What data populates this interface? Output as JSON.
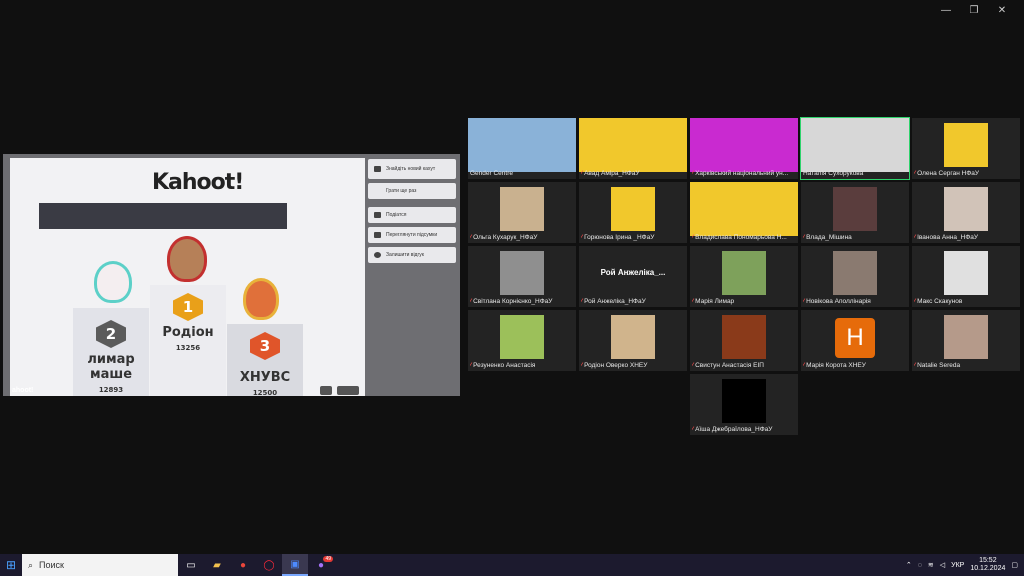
{
  "window": {
    "controls": [
      "—",
      "❐",
      "✕"
    ]
  },
  "kahoot": {
    "logo": "Kahoot!",
    "corner_logo": "ahoot!",
    "podium": [
      {
        "rank": "2",
        "name": "лимар маше",
        "score": "12893",
        "color": "#5b5b5b"
      },
      {
        "rank": "1",
        "name": "Родіон",
        "score": "13256",
        "color": "#e9a019"
      },
      {
        "rank": "3",
        "name": "ХНУВС",
        "score": "12500",
        "color": "#e0552a"
      }
    ],
    "menu": [
      "Знайдіть новий кахут",
      "Грати ще раз",
      "Подіатся",
      "Переглянути підсумки",
      "Залишити відгук"
    ]
  },
  "gallery": {
    "participants": [
      {
        "name": "Gender Centre",
        "muted": false,
        "bg": "#8ab2d8"
      },
      {
        "name": "Авад Аміра_НФаУ",
        "muted": true,
        "bg": "#f1c82c"
      },
      {
        "name": "Харківський національний ун...",
        "muted": true,
        "bg": "#c92ad0"
      },
      {
        "name": "Наталія Сухорукова",
        "muted": false,
        "bg": "#d7d7d7"
      },
      {
        "name": "Олена Серган НФаУ",
        "muted": true,
        "bg": "#f1c82c"
      },
      {
        "name": "Ольга Кухарук_НФаУ",
        "muted": true,
        "bg": "#c9b18f"
      },
      {
        "name": "Горюнова Ірина _НФаУ",
        "muted": true,
        "bg": "#f1c82c"
      },
      {
        "name": "Владислава Пономарьова Н...",
        "muted": true,
        "bg": "#f1c82c"
      },
      {
        "name": "Влада_Мішина",
        "muted": true,
        "bg": "#5a3d3d"
      },
      {
        "name": "Іванова Анна_НФаУ",
        "muted": true,
        "bg": "#d1c3b8"
      },
      {
        "name": "Світлана Корнієнко_НФаУ",
        "muted": true,
        "bg": "#8f8f8f"
      },
      {
        "name": "Рой Анжеліка_НФаУ",
        "muted": true,
        "bg": "#232323",
        "big_text": "Рой Анжеліка_..."
      },
      {
        "name": "Марія Лимар",
        "muted": true,
        "bg": "#7ea15b"
      },
      {
        "name": "Новікова Аполлінарія",
        "muted": true,
        "bg": "#8a7a70"
      },
      {
        "name": "Макс Скакунов",
        "muted": true,
        "bg": "#e0e0e0"
      },
      {
        "name": "Резуненко Анастасія",
        "muted": true,
        "bg": "#9cc05a"
      },
      {
        "name": "Родіон Оверко ХНЕУ",
        "muted": true,
        "bg": "#d0b48c"
      },
      {
        "name": "Свистун Анастасія ЕІП",
        "muted": true,
        "bg": "#8a3a1a"
      },
      {
        "name": "Марія Корота ХНЕУ",
        "muted": true,
        "bg": "#232323",
        "initial": "H"
      },
      {
        "name": "Natalie Sereda",
        "muted": true,
        "bg": "#b59a8a"
      },
      {
        "name": "Аїша Джебраїлова_НФаУ",
        "muted": true,
        "bg": "#000000"
      }
    ]
  },
  "taskbar": {
    "search_placeholder": "Поиск",
    "zoom_badge": "49",
    "lang": "УКР",
    "time": "15:52",
    "date": "10.12.2024"
  }
}
